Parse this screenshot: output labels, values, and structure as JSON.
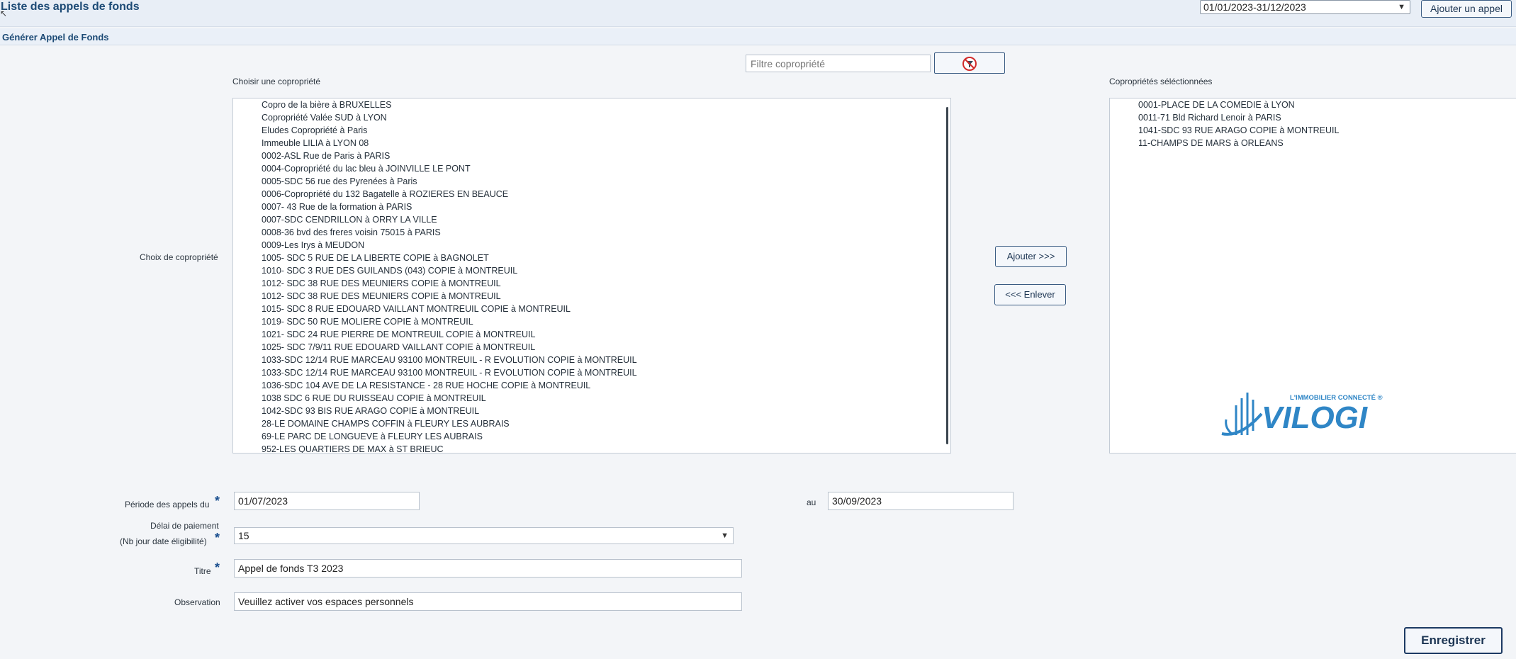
{
  "header": {
    "title": "Liste des appels de fonds",
    "period_value": "01/01/2023-31/12/2023",
    "add_call_label": "Ajouter un appel"
  },
  "subbar": {
    "label": "Générer Appel de Fonds"
  },
  "filter": {
    "placeholder": "Filtre copropriété",
    "clear_icon": "no-filter-icon"
  },
  "labels": {
    "choose": "Choisir une copropriété",
    "selected": "Copropriétés séléctionnées",
    "choice_row": "Choix de copropriété"
  },
  "available": [
    "Copro de la bière à BRUXELLES",
    "Copropriété Valée SUD à LYON",
    "Eludes Copropriété à Paris",
    "Immeuble LILIA à LYON 08",
    "0002-ASL Rue de Paris à PARIS",
    "0004-Copropriété du lac bleu à JOINVILLE LE PONT",
    "0005-SDC 56 rue des Pyrenées à Paris",
    "0006-Copropriété du 132 Bagatelle à ROZIERES EN BEAUCE",
    "0007- 43 Rue de la formation à PARIS",
    "0007-SDC CENDRILLON à ORRY LA VILLE",
    "0008-36 bvd des freres voisin 75015 à PARIS",
    "0009-Les Irys à MEUDON",
    "1005- SDC 5 RUE DE LA LIBERTE COPIE à BAGNOLET",
    "1010- SDC 3 RUE DES GUILANDS (043) COPIE à MONTREUIL",
    "1012- SDC 38 RUE DES MEUNIERS COPIE à MONTREUIL",
    "1012- SDC 38 RUE DES MEUNIERS COPIE à MONTREUIL",
    "1015- SDC 8 RUE EDOUARD VAILLANT MONTREUIL COPIE à MONTREUIL",
    "1019- SDC 50 RUE MOLIERE COPIE à MONTREUIL",
    "1021- SDC 24 RUE PIERRE DE MONTREUIL COPIE à MONTREUIL",
    "1025- SDC 7/9/11 RUE EDOUARD VAILLANT COPIE à MONTREUIL",
    "1033-SDC 12/14 RUE MARCEAU 93100 MONTREUIL - R EVOLUTION COPIE à MONTREUIL",
    "1033-SDC 12/14 RUE MARCEAU 93100 MONTREUIL - R EVOLUTION COPIE à MONTREUIL",
    "1036-SDC 104 AVE DE LA RESISTANCE - 28 RUE HOCHE COPIE à MONTREUIL",
    "1038 SDC 6 RUE DU RUISSEAU COPIE à MONTREUIL",
    "1042-SDC 93 BIS RUE ARAGO COPIE à MONTREUIL",
    "28-LE DOMAINE CHAMPS COFFIN à FLEURY LES AUBRAIS",
    "69-LE PARC DE LONGUEVE à FLEURY LES AUBRAIS",
    "952-LES QUARTIERS DE MAX à ST BRIEUC"
  ],
  "selected": [
    "0001-PLACE DE LA COMEDIE à LYON",
    "0011-71 Bld Richard Lenoir à PARIS",
    "1041-SDC 93 RUE ARAGO COPIE à MONTREUIL",
    "11-CHAMPS DE MARS à ORLEANS"
  ],
  "buttons": {
    "add": "Ajouter >>>",
    "remove": "<<< Enlever",
    "save": "Enregistrer"
  },
  "logo": {
    "tagline": "L'IMMOBILIER CONNECTÉ ®",
    "name": "VILOGI"
  },
  "form": {
    "period_label": "Période des appels du",
    "period_from": "01/07/2023",
    "to_label": "au",
    "period_to": "30/09/2023",
    "delay_label_1": "Délai de paiement",
    "delay_label_2": "(Nb jour date éligibilité)",
    "delay_value": "15",
    "title_label": "Titre",
    "title_value": "Appel de fonds T3 2023",
    "obs_label": "Observation",
    "obs_value": "Veuillez activer vos espaces personnels",
    "required_mark": "*"
  },
  "colors": {
    "accent": "#1c4a75",
    "logo": "#2f86c6",
    "background": "#f3f5f8"
  }
}
